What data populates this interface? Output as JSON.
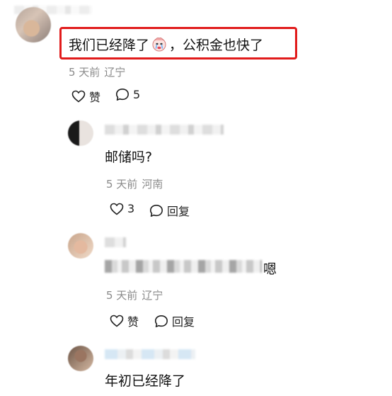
{
  "comment": {
    "text_before_emoji": "我们已经降了",
    "emoji": "crying-face-emoji",
    "text_after_emoji": "，公积金也快了",
    "time": "5 天前",
    "location": "辽宁",
    "like_label": "赞",
    "reply_count": "5",
    "highlight_color": "#e11b1b"
  },
  "replies": [
    {
      "text": "邮储吗?",
      "time": "5 天前",
      "location": "河南",
      "like_count": "3",
      "reply_label": "回复"
    },
    {
      "text_tail": "嗯",
      "time": "5 天前",
      "location": "辽宁",
      "like_label": "赞",
      "reply_label": "回复"
    },
    {
      "text": "年初已经降了"
    }
  ]
}
